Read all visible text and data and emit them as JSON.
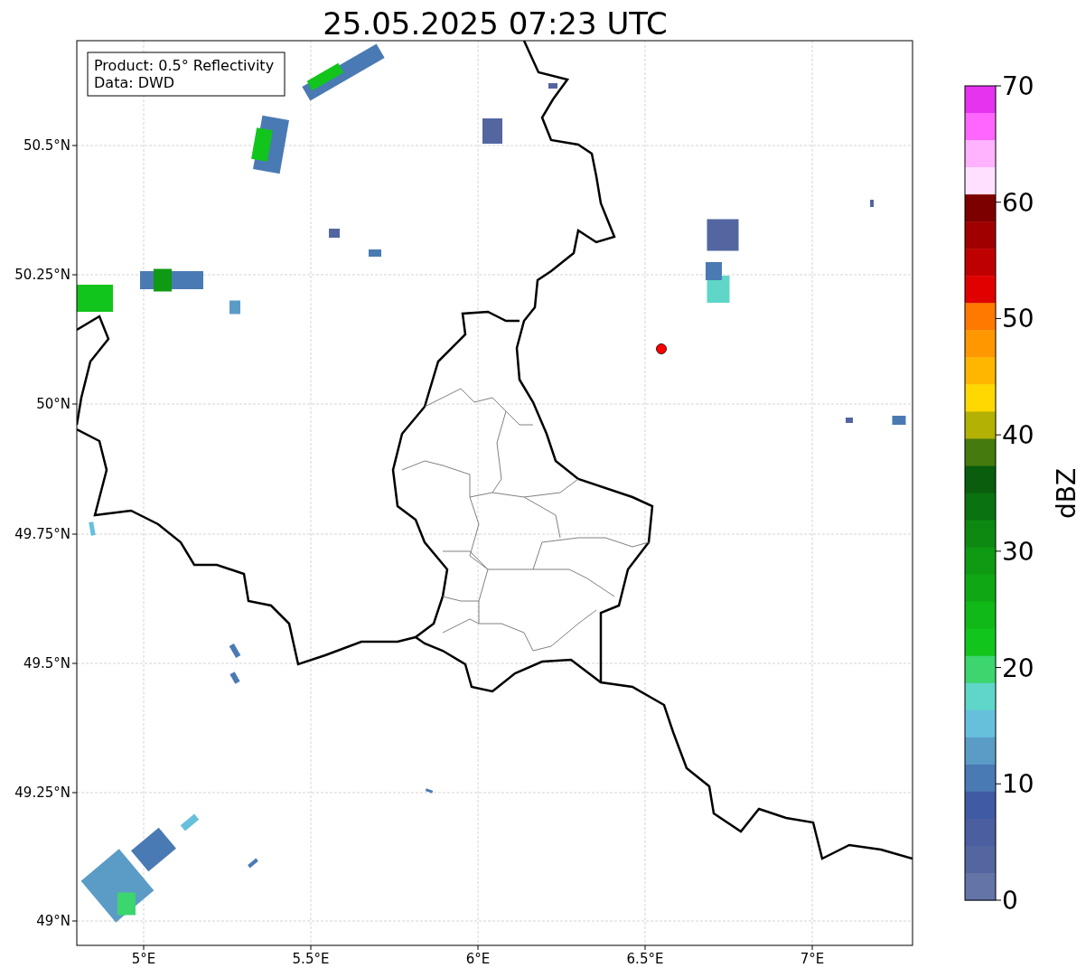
{
  "title": "25.05.2025 07:23 UTC",
  "info_box": {
    "lines": [
      "Product: 0.5° Reflectivity",
      "Data: DWD"
    ]
  },
  "map": {
    "xticks": [
      "5°E",
      "5.5°E",
      "6°E",
      "6.5°E",
      "7°E"
    ],
    "yticks": [
      "50.5°N",
      "50.25°N",
      "50°N",
      "49.75°N",
      "49.5°N",
      "49.25°N",
      "49°N"
    ]
  },
  "colorbar": {
    "label": "dBZ",
    "ticks": [
      "70",
      "60",
      "50",
      "40",
      "30",
      "20",
      "10",
      "0"
    ],
    "bands": [
      {
        "color": "#e533f0"
      },
      {
        "color": "#ff66ff"
      },
      {
        "color": "#ffb3ff"
      },
      {
        "color": "#ffe0ff"
      },
      {
        "color": "#7c0000"
      },
      {
        "color": "#a00000"
      },
      {
        "color": "#bf0000"
      },
      {
        "color": "#e00000"
      },
      {
        "color": "#fe7900"
      },
      {
        "color": "#fe9700"
      },
      {
        "color": "#feb600"
      },
      {
        "color": "#fed800"
      },
      {
        "color": "#b3b103"
      },
      {
        "color": "#457a0e"
      },
      {
        "color": "#095d0d"
      },
      {
        "color": "#0a7210"
      },
      {
        "color": "#0d8912"
      },
      {
        "color": "#0e9a12"
      },
      {
        "color": "#0fa814"
      },
      {
        "color": "#10b918"
      },
      {
        "color": "#12c51c"
      },
      {
        "color": "#3cd56e"
      },
      {
        "color": "#5fd6c8"
      },
      {
        "color": "#66c0dc"
      },
      {
        "color": "#5b9cc6"
      },
      {
        "color": "#4a7ab3"
      },
      {
        "color": "#405ba3"
      },
      {
        "color": "#4b5ea0"
      },
      {
        "color": "#5366a0"
      },
      {
        "color": "#6474a6"
      }
    ]
  },
  "site_marker": {
    "color": "#ff0000"
  }
}
